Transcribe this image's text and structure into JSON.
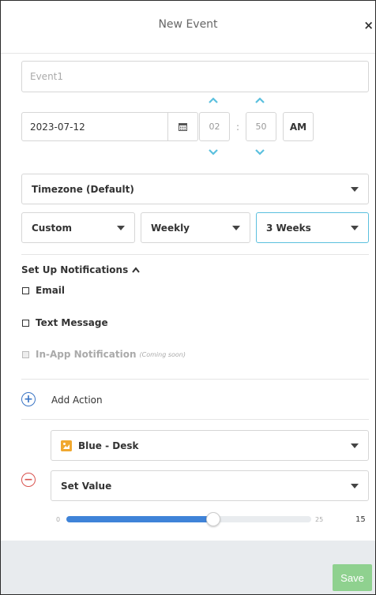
{
  "header": {
    "title": "New Event",
    "close": "×"
  },
  "event_name": {
    "placeholder": "Event1",
    "value": ""
  },
  "date": {
    "value": "2023-07-12"
  },
  "time": {
    "hour": "02",
    "minute": "50",
    "separator": ":",
    "ampm": "AM"
  },
  "timezone": {
    "selected": "Timezone (Default)"
  },
  "recurrence": {
    "type": "Custom",
    "frequency": "Weekly",
    "interval": "3 Weeks"
  },
  "notifications": {
    "title": "Set Up Notifications",
    "options": [
      {
        "label": "Email",
        "checked": false,
        "disabled": false
      },
      {
        "label": "Text Message",
        "checked": false,
        "disabled": false
      },
      {
        "label": "In-App Notification",
        "note": "(Coming soon)",
        "checked": false,
        "disabled": true
      }
    ]
  },
  "actions": {
    "add_label": "Add Action",
    "device": "Blue - Desk",
    "property": "Set Value",
    "slider": {
      "min": "0",
      "max": "25",
      "value": "15",
      "fraction": 0.6
    }
  },
  "footer": {
    "save_label": "Save"
  },
  "colors": {
    "accent": "#5bc0de",
    "primary": "#3f83d8",
    "danger": "#d9534f",
    "save": "#8fd18f",
    "device_icon": "#f0a830"
  }
}
